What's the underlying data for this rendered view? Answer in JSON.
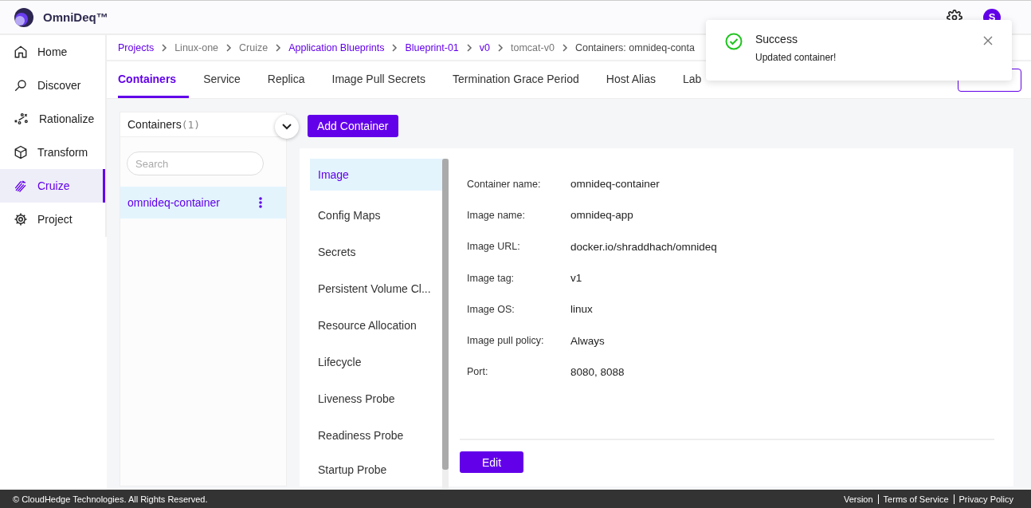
{
  "app": {
    "name": "OmniDeq™",
    "avatar": "S"
  },
  "sidebar": {
    "items": [
      {
        "label": "Home",
        "selected": false
      },
      {
        "label": "Discover",
        "selected": false
      },
      {
        "label": "Rationalize",
        "selected": false
      },
      {
        "label": "Transform",
        "selected": false
      },
      {
        "label": "Cruize",
        "selected": true
      },
      {
        "label": "Project",
        "selected": false
      }
    ]
  },
  "breadcrumb": [
    {
      "label": "Projects",
      "link": true
    },
    {
      "label": "Linux-one",
      "link": false
    },
    {
      "label": "Cruize",
      "link": false
    },
    {
      "label": "Application Blueprints",
      "link": true
    },
    {
      "label": "Blueprint-01",
      "link": true
    },
    {
      "label": "v0",
      "link": true
    },
    {
      "label": "tomcat-v0",
      "link": false
    },
    {
      "label": "Containers: omnideq-conta",
      "link": false
    }
  ],
  "tabs": [
    {
      "label": "Containers",
      "selected": true
    },
    {
      "label": "Service",
      "selected": false
    },
    {
      "label": "Replica",
      "selected": false
    },
    {
      "label": "Image Pull Secrets",
      "selected": false
    },
    {
      "label": "Termination Grace Period",
      "selected": false
    },
    {
      "label": "Host Alias",
      "selected": false
    },
    {
      "label": "Lab",
      "selected": false
    }
  ],
  "containers_panel": {
    "title": "Containers",
    "count": "(1)",
    "search": {
      "placeholder": "Search"
    },
    "items": [
      {
        "name": "omnideq-container",
        "selected": true
      }
    ]
  },
  "add_button": "Add Container",
  "sections": [
    {
      "label": "Image",
      "selected": true
    },
    {
      "label": "Config Maps",
      "selected": false
    },
    {
      "label": "Secrets",
      "selected": false
    },
    {
      "label": "Persistent Volume Cl...",
      "selected": false
    },
    {
      "label": "Resource Allocation",
      "selected": false
    },
    {
      "label": "Lifecycle",
      "selected": false
    },
    {
      "label": "Liveness Probe",
      "selected": false
    },
    {
      "label": "Readiness Probe",
      "selected": false
    },
    {
      "label": "Startup Probe",
      "selected": false
    }
  ],
  "details": [
    {
      "label": "Container name:",
      "value": "omnideq-container"
    },
    {
      "label": "Image name:",
      "value": "omnideq-app"
    },
    {
      "label": "Image URL:",
      "value": "docker.io/shraddhach/omnideq"
    },
    {
      "label": "Image tag:",
      "value": "v1"
    },
    {
      "label": "Image OS:",
      "value": "linux"
    },
    {
      "label": "Image pull policy:",
      "value": "Always"
    },
    {
      "label": "Port:",
      "value": "8080, 8088"
    }
  ],
  "edit_button": "Edit",
  "toast": {
    "kind": "success",
    "title": "Success",
    "message": "Updated container!"
  },
  "footer": {
    "copyright": "© CloudHedge Technologies. All Rights Reserved.",
    "links": [
      "Version",
      "Terms of Service",
      "Privacy Policy"
    ]
  }
}
